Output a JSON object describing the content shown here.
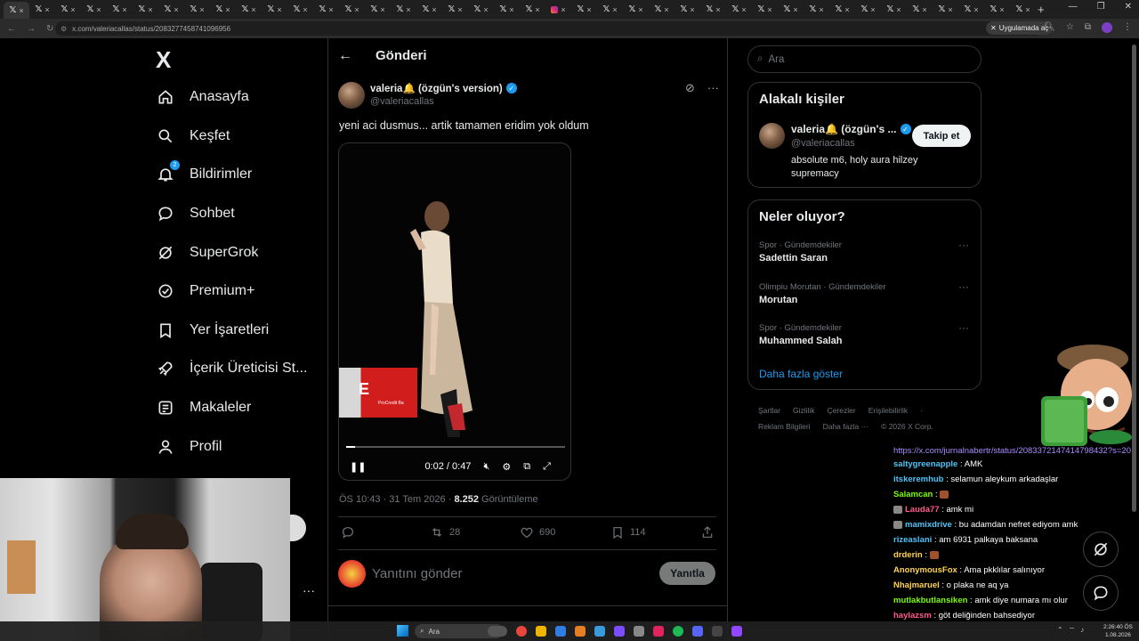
{
  "browser": {
    "tabs": [
      {
        "kind": "x",
        "label": "ⓧ"
      },
      {
        "kind": "x",
        "label": "ⓧ"
      },
      {
        "kind": "x",
        "label": "ⓧ"
      },
      {
        "kind": "x",
        "label": "ⓧ"
      },
      {
        "kind": "x",
        "label": "ⓧ"
      },
      {
        "kind": "x",
        "label": "ⓧ"
      },
      {
        "kind": "x",
        "label": "ⓧ"
      },
      {
        "kind": "x",
        "label": "ⓧ"
      },
      {
        "kind": "x",
        "label": "ⓧ"
      },
      {
        "kind": "x",
        "label": "ⓧ"
      },
      {
        "kind": "x",
        "label": "ⓧ"
      },
      {
        "kind": "x",
        "label": "ⓧ"
      },
      {
        "kind": "x",
        "label": "ⓧ"
      },
      {
        "kind": "x",
        "label": "ⓧ"
      },
      {
        "kind": "x",
        "label": "ⓧ"
      },
      {
        "kind": "x",
        "label": "ⓧ"
      },
      {
        "kind": "x",
        "label": "ⓧ"
      },
      {
        "kind": "x",
        "label": "ⓧ"
      },
      {
        "kind": "x",
        "label": "ⓧ"
      },
      {
        "kind": "x",
        "label": "ⓧ"
      },
      {
        "kind": "x",
        "label": "ⓧ"
      },
      {
        "kind": "ig",
        "label": "ⓧ"
      },
      {
        "kind": "x",
        "label": "ⓧ"
      },
      {
        "kind": "x",
        "label": "ⓧ"
      },
      {
        "kind": "x",
        "label": "ⓧ"
      },
      {
        "kind": "x",
        "label": "ⓧ"
      },
      {
        "kind": "x",
        "label": "ⓧ"
      },
      {
        "kind": "x",
        "label": "ⓧ"
      },
      {
        "kind": "x",
        "label": "ⓧ"
      },
      {
        "kind": "x",
        "label": "ⓧ"
      },
      {
        "kind": "x",
        "label": "ⓧ"
      },
      {
        "kind": "x",
        "label": "ⓧ"
      },
      {
        "kind": "x",
        "label": "ⓧ"
      },
      {
        "kind": "x",
        "label": "ⓧ"
      },
      {
        "kind": "x",
        "label": "ⓧ"
      },
      {
        "kind": "x",
        "label": "ⓧ"
      },
      {
        "kind": "x",
        "label": "ⓧ"
      },
      {
        "kind": "x",
        "label": "ⓧ"
      },
      {
        "kind": "x",
        "label": "ⓧ"
      },
      {
        "kind": "x",
        "label": "ⓧ"
      }
    ],
    "url": "x.com/valeriacallas/status/2083277458741096956",
    "app_pill": "Uygulamada aç"
  },
  "nav": {
    "logo": "X",
    "items": [
      {
        "label": "Anasayfa",
        "icon": "home-icon"
      },
      {
        "label": "Keşfet",
        "icon": "search-icon"
      },
      {
        "label": "Bildirimler",
        "icon": "bell-icon",
        "badge": "2"
      },
      {
        "label": "Sohbet",
        "icon": "chat-icon"
      },
      {
        "label": "SuperGrok",
        "icon": "grok-icon"
      },
      {
        "label": "Premium+",
        "icon": "premium-icon"
      },
      {
        "label": "Yer İşaretleri",
        "icon": "bookmark-icon"
      },
      {
        "label": "İçerik Üreticisi St...",
        "icon": "rocket-icon"
      },
      {
        "label": "Makaleler",
        "icon": "article-icon"
      },
      {
        "label": "Profil",
        "icon": "profile-icon"
      }
    ]
  },
  "post": {
    "page_title": "Gönderi",
    "author_name": "valeria🔔 (özgün's version)",
    "author_handle": "@valeriacallas",
    "text": "yeni aci dusmus... artik tamamen eridim yok oldum",
    "video": {
      "time": "0:02 / 0:47",
      "progress": 0.04,
      "ad_text": "ProCredit Ba"
    },
    "timestamp": "ÖS 10:43 · 31 Tem 2026 · ",
    "views_count": "8.252",
    "views_label": " Görüntüleme",
    "retweets": "28",
    "likes": "690",
    "bookmarks": "114",
    "reply_placeholder": "Yanıtını gönder",
    "reply_button": "Yanıtla"
  },
  "sidebar": {
    "search_placeholder": "Ara",
    "related_title": "Alakalı kişiler",
    "related": {
      "name": "valeria🔔 (özgün's ...",
      "handle": "@valeriacallas",
      "bio": "absolute m6, holy aura hilzey supremacy",
      "follow": "Takip et"
    },
    "trends_title": "Neler oluyor?",
    "trends": [
      {
        "category": "Spor · Gündemdekiler",
        "name": "Sadettin Saran"
      },
      {
        "category": "Olimpiu Morutan · Gündemdekiler",
        "name": "Morutan"
      },
      {
        "category": "Spor · Gündemdekiler",
        "name": "Muhammed Salah"
      }
    ],
    "show_more": "Daha fazla göster",
    "footer_row1": [
      "Şartlar",
      "Gizlilik",
      "Çerezler",
      "Erişilebilirlik",
      "·"
    ],
    "footer_row2": [
      "Reklam Bilgileri",
      "Daha fazla ···",
      "© 2026 X Corp."
    ]
  },
  "chat": {
    "link": "https://x.com/jurnalnabertr/status/2083372147414798432?s=20",
    "messages": [
      {
        "user": "saltygreenapple",
        "color": "#4fc3f7",
        "text": "AMK"
      },
      {
        "user": "itskeremhub",
        "color": "#4fc3f7",
        "text": "selamun aleykum arkadaşlar"
      },
      {
        "user": "Salamcan",
        "color": "#7cfc00",
        "text": "",
        "emote": true
      },
      {
        "user": "Lauda77",
        "color": "#ff5a8a",
        "text": "amk mi",
        "badge": true
      },
      {
        "user": "mamixdrive",
        "color": "#4fc3f7",
        "text": "bu adamdan nefret ediyom amk",
        "badge": true
      },
      {
        "user": "rizeaslani",
        "color": "#4fc3f7",
        "text": "am 6931 palkaya baksana"
      },
      {
        "user": "drderin",
        "color": "#ffd54f",
        "text": "",
        "emote": true
      },
      {
        "user": "AnonymousFox",
        "color": "#ffd54f",
        "text": "Ama pkklılar salınıyor"
      },
      {
        "user": "Nhajmaruel",
        "color": "#ffd54f",
        "text": "o plaka ne aq ya"
      },
      {
        "user": "mutlakbutlansiken",
        "color": "#7cfc00",
        "text": "amk diye numara mı olur"
      },
      {
        "user": "haylazsm",
        "color": "#ff5a8a",
        "text": "göt deliğinden bahsediyor"
      }
    ]
  },
  "taskbar": {
    "search": "Ara",
    "time": "2:26:40 ÖS",
    "date": "1.08.2026"
  },
  "colors": {
    "accent": "#1d9bf0",
    "background": "#000000",
    "border": "#2f3336",
    "muted": "#71767b"
  }
}
